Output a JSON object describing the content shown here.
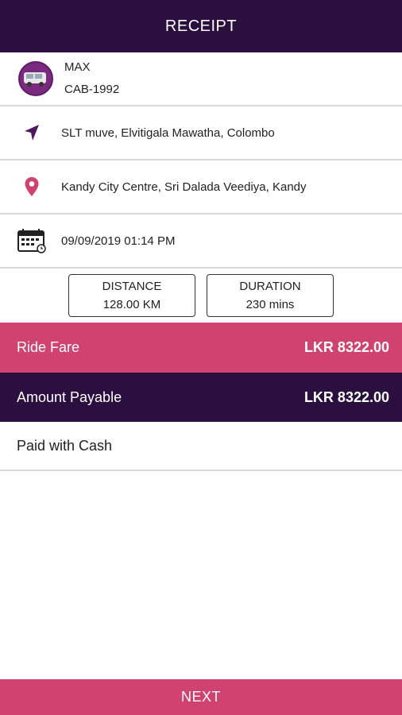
{
  "header": {
    "title": "RECEIPT"
  },
  "vehicle": {
    "type": "MAX",
    "plate": "CAB-1992",
    "icon": "car-icon"
  },
  "trip": {
    "pickup": "SLT muve, Elvitigala Mawatha, Colombo",
    "pickup_icon": "navigation-arrow-icon",
    "dropoff": "Kandy City Centre, Sri Dalada Veediya, Kandy",
    "dropoff_icon": "location-pin-icon",
    "datetime": "09/09/2019 01:14 PM",
    "datetime_icon": "calendar-icon"
  },
  "stats": {
    "distance_label": "DISTANCE",
    "distance_value": "128.00 KM",
    "duration_label": "DURATION",
    "duration_value": "230 mins"
  },
  "fare": {
    "ride_fare_label": "Ride Fare",
    "ride_fare_value": "LKR 8322.00",
    "amount_payable_label": "Amount Payable",
    "amount_payable_value": "LKR 8322.00",
    "payment_method": "Paid with Cash"
  },
  "actions": {
    "next_label": "NEXT"
  },
  "colors": {
    "primary_dark": "#2b0f3f",
    "accent_pink": "#d0436e",
    "avatar_purple": "#7a2a7f"
  }
}
